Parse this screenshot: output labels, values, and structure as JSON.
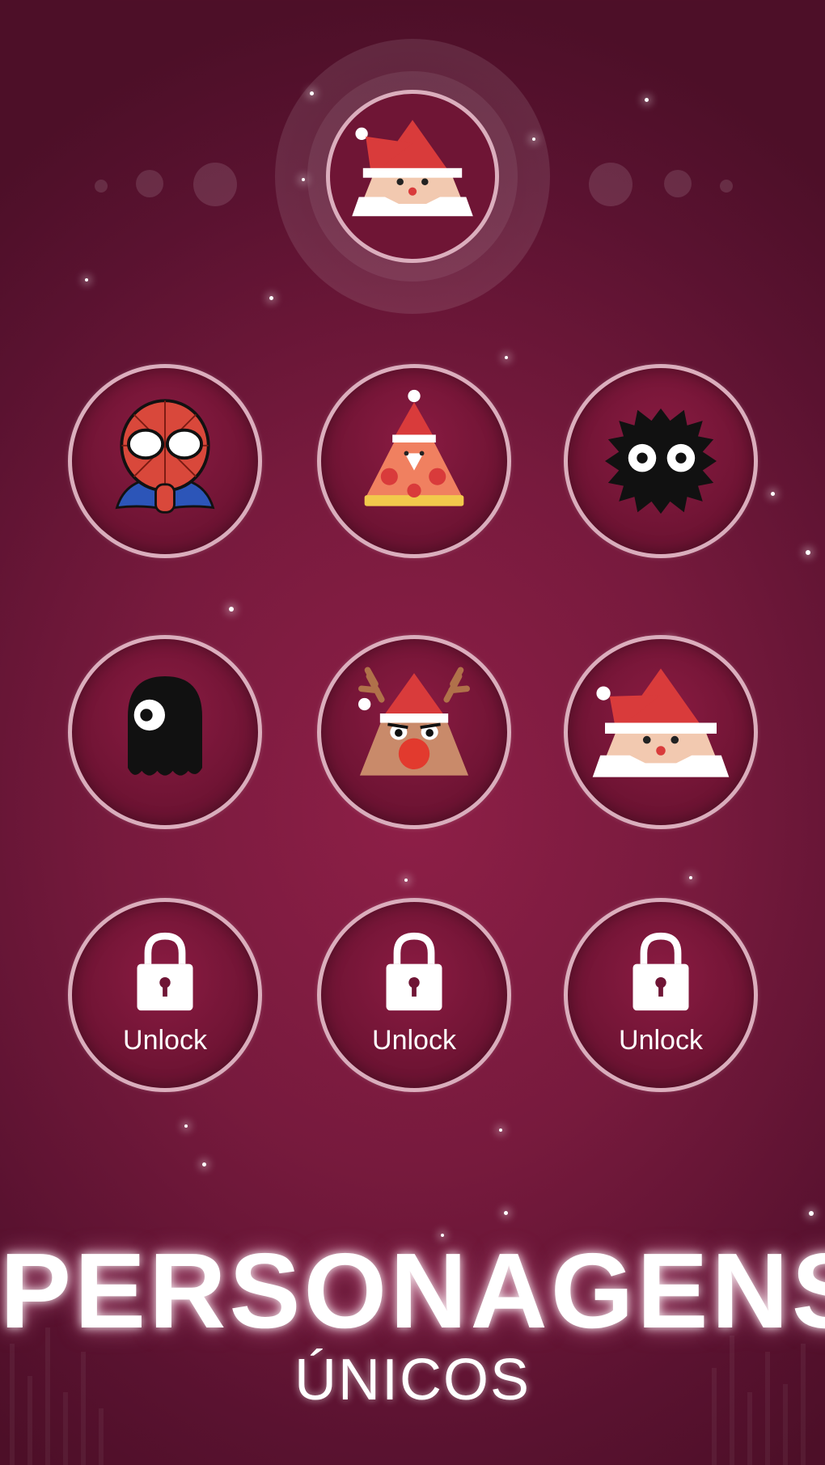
{
  "selected_character": {
    "icon": "santa-triangle-icon"
  },
  "grid": [
    {
      "icon": "spider-hero-icon",
      "locked": false
    },
    {
      "icon": "pizza-santa-icon",
      "locked": false
    },
    {
      "icon": "black-fuzzball-icon",
      "locked": false
    },
    {
      "icon": "black-blob-icon",
      "locked": false
    },
    {
      "icon": "reindeer-icon",
      "locked": false
    },
    {
      "icon": "santa-triangle-icon",
      "locked": false
    },
    {
      "icon": "lock-icon",
      "locked": true,
      "label": "Unlock"
    },
    {
      "icon": "lock-icon",
      "locked": true,
      "label": "Unlock"
    },
    {
      "icon": "lock-icon",
      "locked": true,
      "label": "Unlock"
    }
  ],
  "headline": {
    "title": "PERSONAGENS",
    "subtitle": "ÚNICOS"
  },
  "colors": {
    "background": "#7a1a40",
    "ring": "#ffe1eb",
    "santa_red": "#d93b3b"
  }
}
